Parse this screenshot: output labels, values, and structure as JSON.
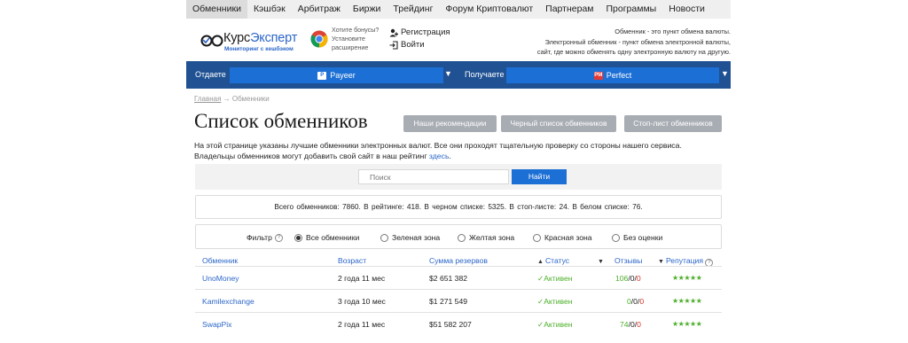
{
  "topnav": [
    {
      "label": "Обменники",
      "active": true
    },
    {
      "label": "Кэшбэк"
    },
    {
      "label": "Арбитраж"
    },
    {
      "label": "Биржи"
    },
    {
      "label": "Трейдинг"
    },
    {
      "label": "Форум Криптовалют"
    },
    {
      "label": "Партнерам"
    },
    {
      "label": "Программы"
    },
    {
      "label": "Новости"
    }
  ],
  "header": {
    "logo_prefix": "Курс",
    "logo_accent": "Эксперт",
    "logo_sub": "Мониторинг с кешбэком",
    "bonus_line1": "Хотите бонусы?",
    "bonus_line2": "Установите",
    "bonus_line3": "расширение",
    "register": "Регистрация",
    "login": "Войти",
    "desc_line1": "Обменник - это пункт обмена валюты.",
    "desc_line2": "Электронный обменник - пункт обмена электронной валюты,",
    "desc_line3": "сайт, где можно обменять одну электронную валюту на другую."
  },
  "exchange": {
    "give_label": "Отдаете",
    "give_value": "Payeer",
    "give_badge": "P",
    "get_label": "Получаете",
    "get_value": "Perfect",
    "get_badge": "PM",
    "arrow": "▼"
  },
  "breadcrumb": {
    "home": "Главная",
    "sep": " → ",
    "current": "Обменники"
  },
  "page": {
    "title": "Список обменников",
    "btn_recommend": "Наши рекомендации",
    "btn_blacklist": "Черный список обменников",
    "btn_stoplist": "Стоп-лист обменников",
    "intro_line1": "На этой странице указаны лучшие обменники электронных валют. Все они проходят тщательную проверку со стороны нашего сервиса.",
    "intro_line2": "Владельцы обменников могут добавить свой сайт в наш рейтинг ",
    "intro_link": "здесь",
    "intro_end": "."
  },
  "search": {
    "placeholder": "Поиск",
    "button": "Найти"
  },
  "stats": {
    "text": "Всего обменников: 7860.   В рейтинге: 418.   В черном списке: 5325.   В стоп-листе: 24.   В белом списке: 76."
  },
  "filter": {
    "label": "Фильтр",
    "options": [
      {
        "label": "Все обменники",
        "selected": true
      },
      {
        "label": "Зеленая зона"
      },
      {
        "label": "Желтая зона"
      },
      {
        "label": "Красная зона"
      },
      {
        "label": "Без оценки"
      }
    ]
  },
  "table": {
    "headers": {
      "name": "Обменник",
      "age": "Возраст",
      "reserves": "Сумма резервов",
      "status": "Статус",
      "reviews": "Отзывы",
      "reputation": "Репутация"
    },
    "rows": [
      {
        "name": "UnoMoney",
        "age": "2 года 11 мес",
        "reserves": "$2 651 382",
        "status": "✓Активен",
        "rev_pos": "106",
        "rev_neu": "0",
        "rev_neg": "0",
        "stars": "★★★★★"
      },
      {
        "name": "Kamilexchange",
        "age": "3 года 10 мес",
        "reserves": "$1 271 549",
        "status": "✓Активен",
        "rev_pos": "0",
        "rev_neu": "0",
        "rev_neg": "0",
        "stars": "★★★★★"
      },
      {
        "name": "SwapPix",
        "age": "2 года 11 мес",
        "reserves": "$51 582 207",
        "status": "✓Активен",
        "rev_pos": "74",
        "rev_neu": "0",
        "rev_neg": "0",
        "stars": "★★★★★"
      }
    ]
  },
  "colors": {
    "nav_bg": "#efefef",
    "bar_bg": "#1f5193",
    "select_bg": "#1c6fd4",
    "link": "#2c66c9",
    "active_green": "#4caf2a",
    "grey_button": "#a8adb4"
  }
}
